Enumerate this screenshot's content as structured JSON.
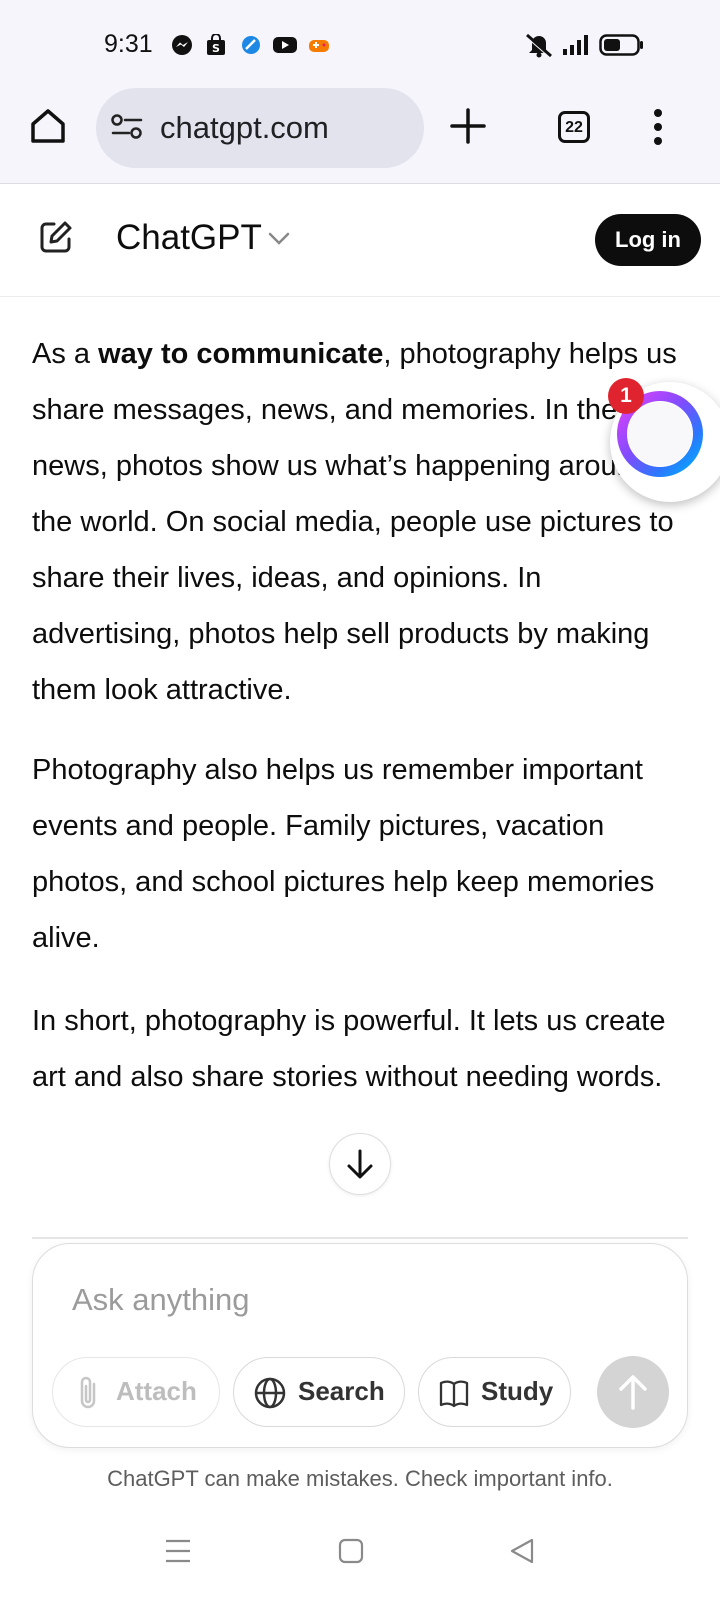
{
  "status_bar": {
    "time": "9:31",
    "notification_icons": [
      "messenger-icon",
      "shop-icon",
      "app-icon",
      "youtube-icon",
      "game-icon"
    ],
    "right_icons": [
      "mute-icon",
      "signal-icon",
      "battery-icon"
    ]
  },
  "browser": {
    "url": "chatgpt.com",
    "tab_count": "22"
  },
  "header": {
    "model_name": "ChatGPT",
    "login_label": "Log in"
  },
  "message": {
    "p1_lead": "As a ",
    "p1_bold": "way to communicate",
    "p1_rest": ", photography helps us share messages, news, and memories. In the news, photos show us what’s happening around the world. On social media, people use pictures to share their lives, ideas, and opinions. In advertising, photos help sell products by making them look attractive.",
    "p2": "Photography also helps us remember important events and people. Family pictures, vacation photos, and school pictures help keep memories alive.",
    "p3": "In short, photography is powerful. It lets us create art and also share stories without needing words."
  },
  "floating_bubble": {
    "badge_count": "1"
  },
  "composer": {
    "placeholder": "Ask anything",
    "attach_label": "Attach",
    "search_label": "Search",
    "study_label": "Study"
  },
  "disclaimer": "ChatGPT can make mistakes. Check important info.",
  "colors": {
    "chrome_bg": "#f5f5fb",
    "url_pill": "#e3e3ee",
    "login_bg": "#0d0d0d",
    "badge": "#e0242f",
    "send_disabled": "#d4d4d4"
  }
}
